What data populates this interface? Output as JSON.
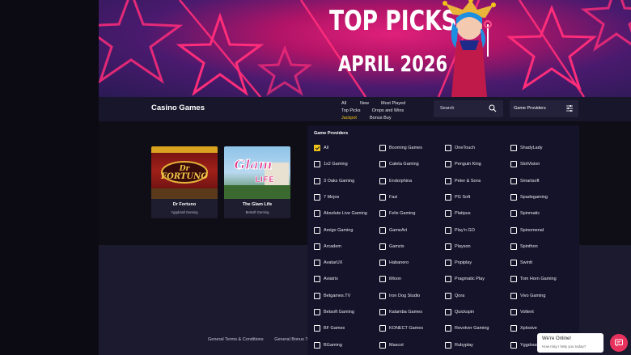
{
  "banner": {
    "line1": "TOP PICKS",
    "line2": "APRIL 2026"
  },
  "toolbar": {
    "heading": "Casino Games",
    "links": [
      "All",
      "New",
      "Most Played",
      "Top Picks",
      "Drops and Wins",
      "Jackpot",
      "Bonus Buy"
    ],
    "active_link": "Jackpot",
    "search_placeholder": "Search",
    "providers_label": "Game Providers"
  },
  "games": [
    {
      "name": "Dr Fortuno",
      "provider": "Yggdrasil Gaming"
    },
    {
      "name": "The Glam Life",
      "provider": "Betsoft Gaming"
    }
  ],
  "dropdown": {
    "title": "Game Providers",
    "columns": [
      [
        "All",
        "1x2 Gaming",
        "3 Oaks Gaming",
        "7 Mojos",
        "Absolute Live Gaming",
        "Amigo Gaming",
        "Arcadem",
        "AvatarUX",
        "Aviatrix",
        "Betgames.TV",
        "Betsoft Gaming",
        "BF Games",
        "BGaming"
      ],
      [
        "Booming Games",
        "Caleta Gaming",
        "Endorphina",
        "Fazi",
        "Felix Gaming",
        "GameArt",
        "Gamzix",
        "Habanero",
        "iMoon",
        "Iron Dog Studio",
        "Kalamba Games",
        "KONECT Games",
        "Mascot"
      ],
      [
        "OneTouch",
        "Penguin King",
        "Peter & Sons",
        "PG Soft",
        "Platipus",
        "Play'n GO",
        "Playson",
        "Popiplay",
        "Pragmatic Play",
        "Qora",
        "Quickspin",
        "Revolver Gaming",
        "Rubyplay"
      ],
      [
        "ShadyLady",
        "SlotVision",
        "Smartsoft",
        "Spadegaming",
        "Spinmatic",
        "Spinomenal",
        "Spinthon",
        "Swintt",
        "Tom Horn Gaming",
        "Vivo Gaming",
        "Voltent",
        "Xplosive",
        "Yggdrasil"
      ]
    ],
    "checked": "All"
  },
  "footer": {
    "links": [
      "General Terms & Conditions",
      "General Bonus T"
    ]
  },
  "chat": {
    "title": "We're Online!",
    "subtitle": "How may I help you today?"
  },
  "colors": {
    "accent": "#f0c419",
    "chat": "#e8325e",
    "banner": "#b11467"
  }
}
